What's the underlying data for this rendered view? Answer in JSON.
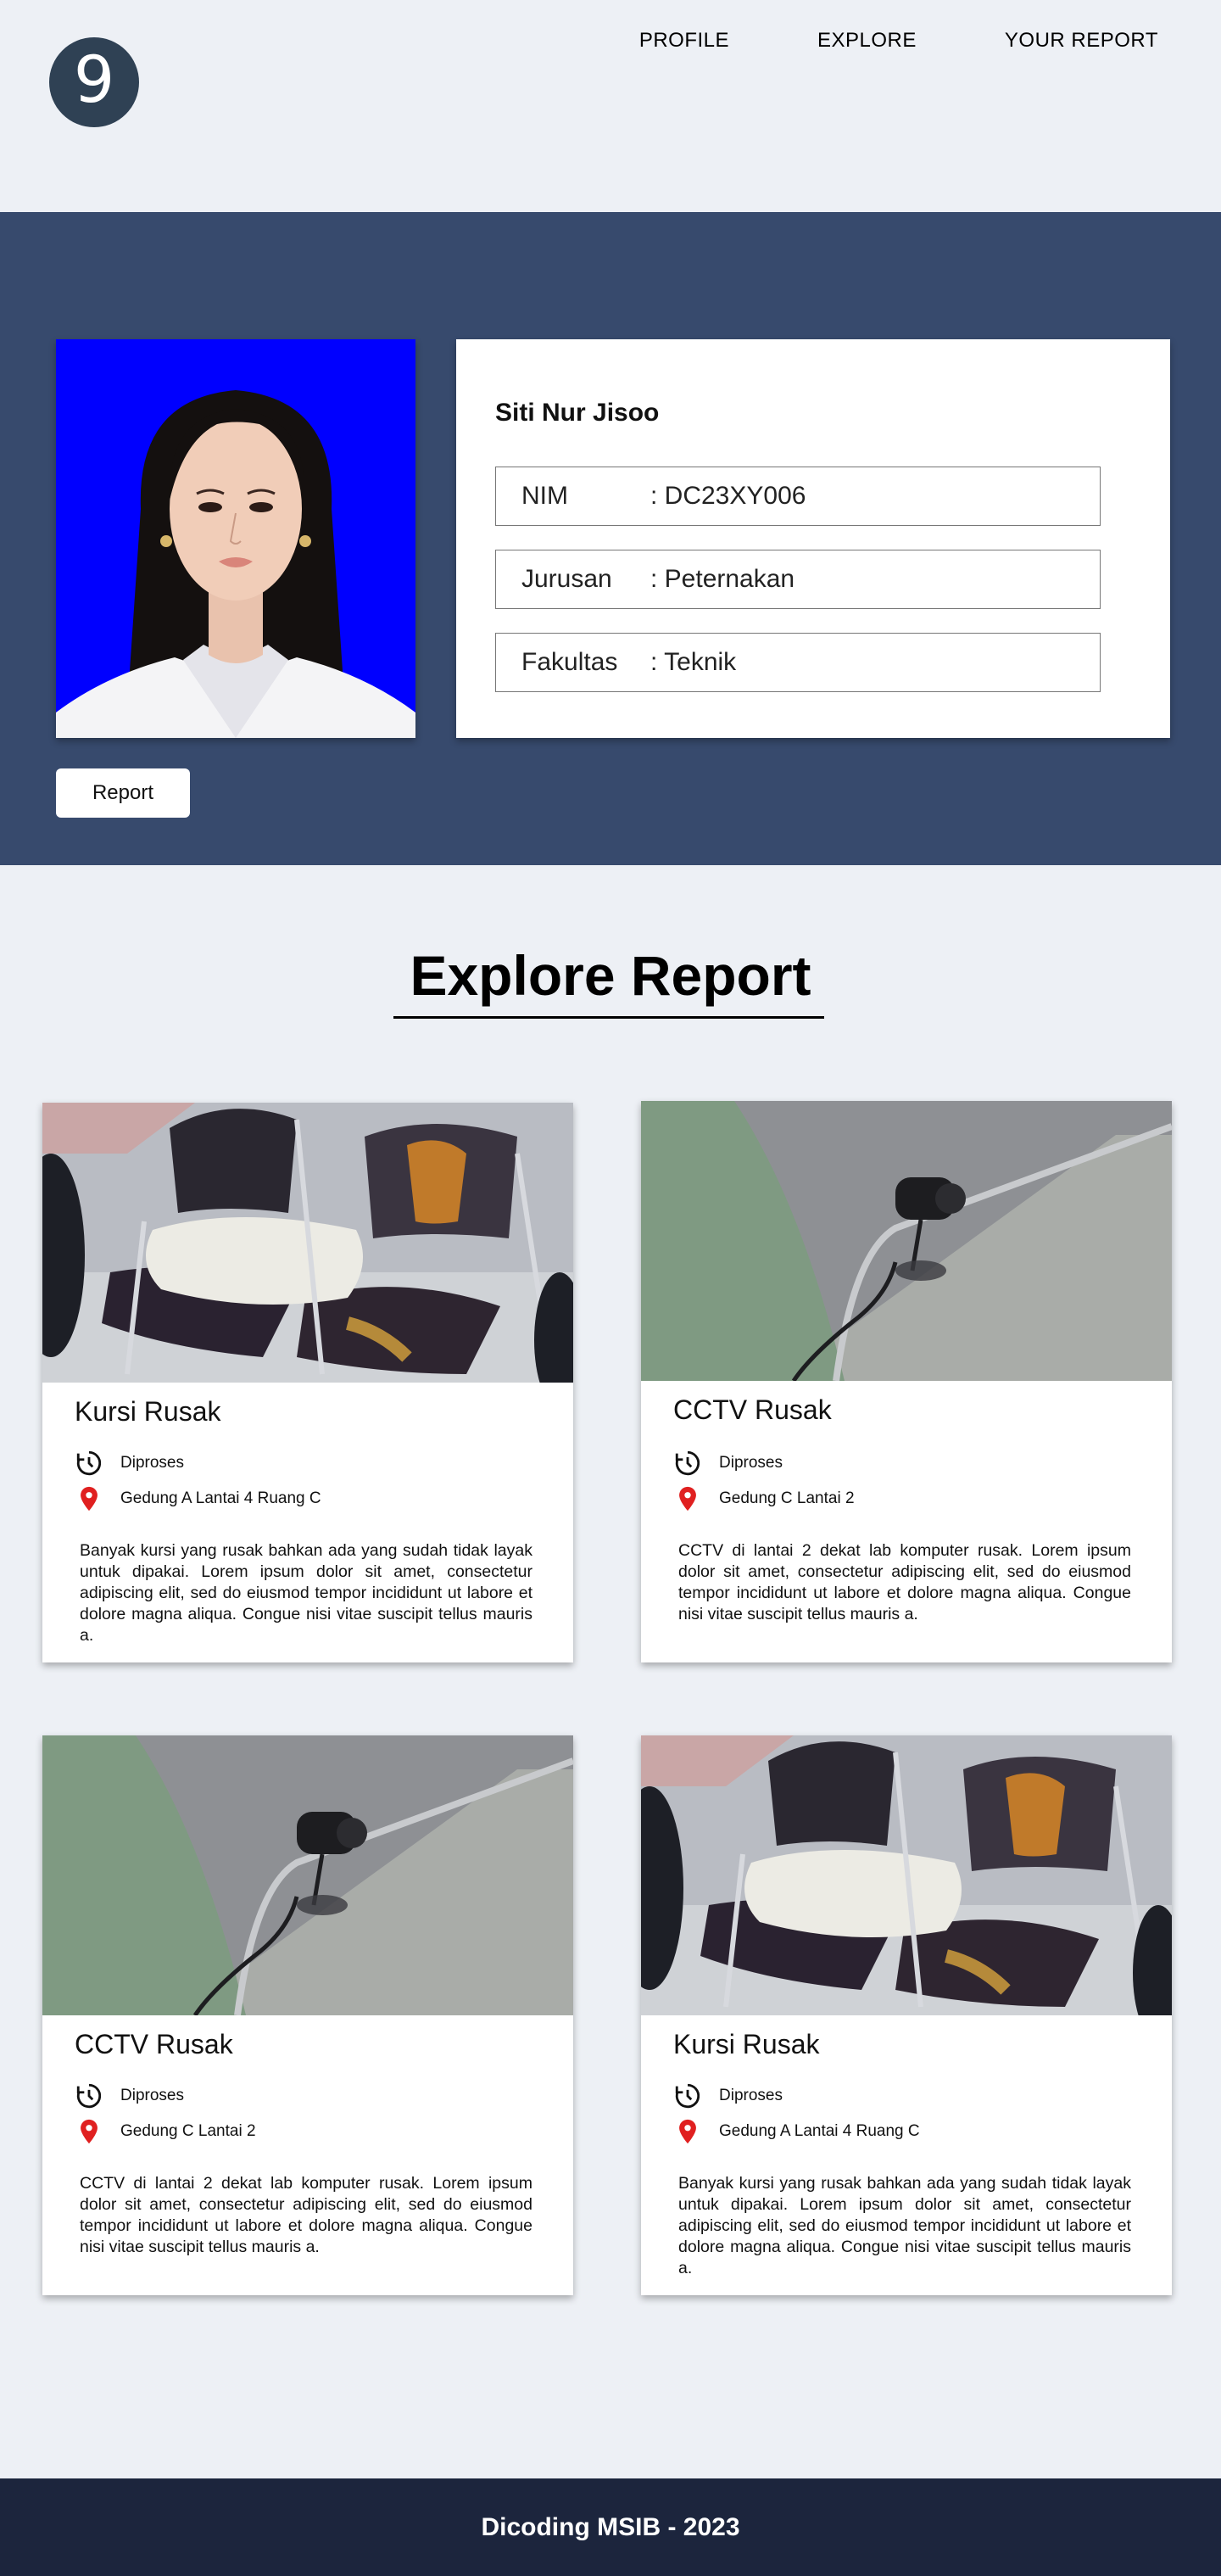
{
  "header": {
    "logo_glyph": "9",
    "nav": [
      "PROFILE",
      "EXPLORE",
      "YOUR REPORT"
    ]
  },
  "profile": {
    "name": "Siti Nur Jisoo",
    "fields": [
      {
        "label": "NIM",
        "value": ": DC23XY006"
      },
      {
        "label": "Jurusan",
        "value": ": Peternakan"
      },
      {
        "label": "Fakultas",
        "value": ": Teknik"
      }
    ],
    "report_button": "Report",
    "photo_background": "#0000ff"
  },
  "explore": {
    "title": "Explore Report",
    "cards": [
      {
        "title": "Kursi Rusak",
        "status": "Diproses",
        "location": "Gedung A Lantai 4 Ruang C",
        "description": "Banyak kursi yang rusak bahkan ada yang sudah tidak layak untuk dipakai. Lorem ipsum dolor sit amet, consectetur adipiscing elit, sed do eiusmod tempor incididunt ut labore et dolore magna aliqua. Congue nisi vitae suscipit tellus mauris a.",
        "image": "chair-photo"
      },
      {
        "title": "CCTV Rusak",
        "status": "Diproses",
        "location": "Gedung C Lantai 2",
        "description": "CCTV di lantai 2 dekat lab komputer rusak. Lorem ipsum dolor sit amet, consectetur adipiscing elit, sed do eiusmod tempor incididunt ut labore et dolore magna aliqua. Congue nisi vitae suscipit tellus mauris a.",
        "image": "cctv-photo"
      },
      {
        "title": "CCTV Rusak",
        "status": "Diproses",
        "location": "Gedung C Lantai 2",
        "description": "CCTV di lantai 2 dekat lab komputer rusak. Lorem ipsum dolor sit amet, consectetur adipiscing elit, sed do eiusmod tempor incididunt ut labore et dolore magna aliqua. Congue nisi vitae suscipit tellus mauris a.",
        "image": "cctv-photo"
      },
      {
        "title": "Kursi Rusak",
        "status": "Diproses",
        "location": "Gedung A Lantai 4 Ruang C",
        "description": "Banyak kursi yang rusak bahkan ada yang sudah tidak layak untuk dipakai. Lorem ipsum dolor sit amet, consectetur adipiscing elit, sed do eiusmod tempor incididunt ut labore et dolore magna aliqua. Congue nisi vitae suscipit tellus mauris a.",
        "image": "chair-photo"
      }
    ]
  },
  "footer": {
    "text": "Dicoding MSIB - 2023"
  },
  "colors": {
    "page_bg": "#edf0f5",
    "profile_band": "#374a6d",
    "logo": "#2f4154",
    "footer": "#1c253d",
    "location_pin": "#e02020"
  }
}
